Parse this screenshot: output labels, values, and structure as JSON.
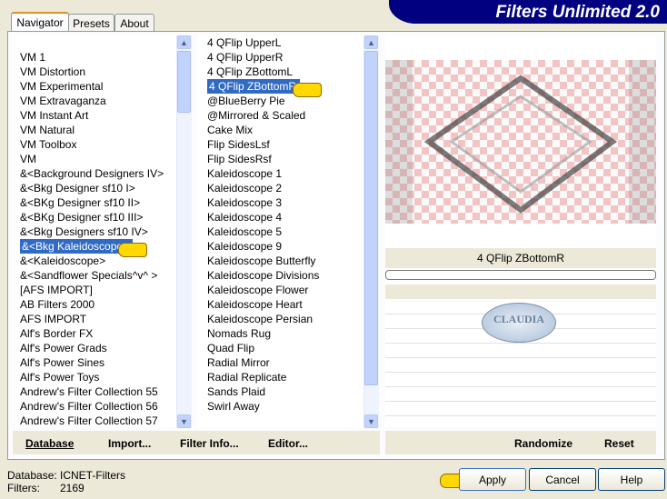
{
  "title": "Filters Unlimited 2.0",
  "tabs": [
    "Navigator",
    "Presets",
    "About"
  ],
  "categories": [
    "",
    "VM 1",
    "VM Distortion",
    "VM Experimental",
    "VM Extravaganza",
    "VM Instant Art",
    "VM Natural",
    "VM Toolbox",
    "VM",
    "&<Background Designers IV>",
    "&<Bkg Designer sf10 I>",
    "&<BKg Designer sf10 II>",
    "&<BKg Designer sf10 III>",
    "&<Bkg Designers sf10 IV>",
    "&<Bkg Kaleidoscope>",
    "&<Kaleidoscope>",
    "&<Sandflower Specials^v^ >",
    "[AFS IMPORT]",
    "AB Filters 2000",
    "AFS IMPORT",
    "Alf's Border FX",
    "Alf's Power Grads",
    "Alf's Power Sines",
    "Alf's Power Toys",
    "Andrew's Filter Collection 55",
    "Andrew's Filter Collection 56",
    "Andrew's Filter Collection 57"
  ],
  "selected_category_index": 14,
  "filters": [
    "4 QFlip UpperL",
    "4 QFlip UpperR",
    "4 QFlip ZBottomL",
    "4 QFlip ZBottomR",
    "@BlueBerry Pie",
    "@Mirrored & Scaled",
    "Cake Mix",
    "Flip SidesLsf",
    "Flip SidesRsf",
    "Kaleidoscope 1",
    "Kaleidoscope 2",
    "Kaleidoscope 3",
    "Kaleidoscope 4",
    "Kaleidoscope 5",
    "Kaleidoscope 9",
    "Kaleidoscope Butterfly",
    "Kaleidoscope Divisions",
    "Kaleidoscope Flower",
    "Kaleidoscope Heart",
    "Kaleidoscope Persian",
    "Nomads Rug",
    "Quad Flip",
    "Radial Mirror",
    "Radial Replicate",
    "Sands Plaid",
    "Swirl Away"
  ],
  "selected_filter_index": 3,
  "preview": {
    "filter_name": "4 QFlip ZBottomR",
    "watermark": "CLAUDIA",
    "progress": 0
  },
  "toolbar": {
    "database": "Database",
    "import": "Import...",
    "filter_info": "Filter Info...",
    "editor": "Editor...",
    "randomize": "Randomize",
    "reset": "Reset"
  },
  "status": {
    "database_label": "Database:",
    "database_value": "ICNET-Filters",
    "filters_label": "Filters:",
    "filters_value": "2169"
  },
  "buttons": {
    "apply": "Apply",
    "cancel": "Cancel",
    "help": "Help"
  },
  "colors": {
    "selection": "#316ac5",
    "banner": "#000080",
    "pointer": "#ffd800"
  }
}
